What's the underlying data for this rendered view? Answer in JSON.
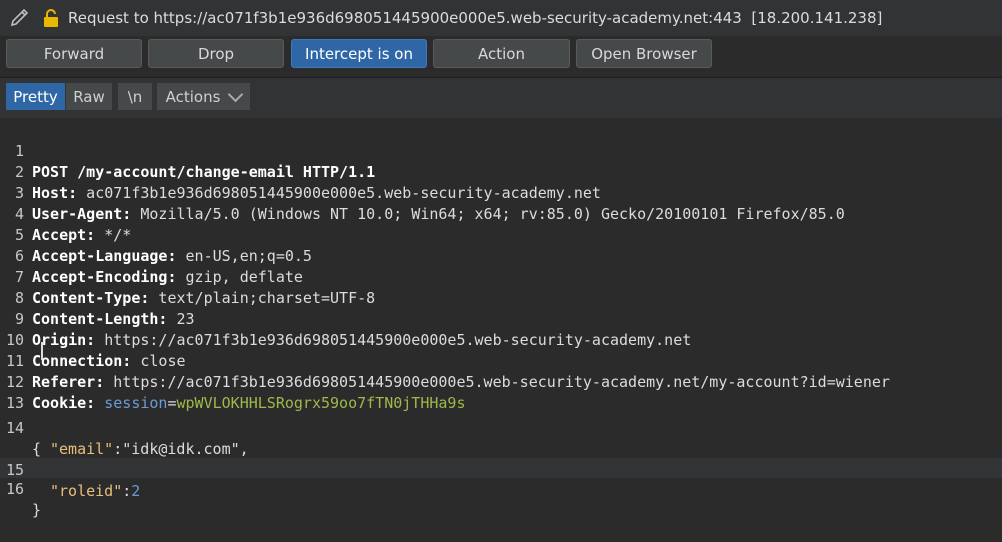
{
  "request_title": "Request to https://ac071f3b1e936d698051445900e000e5.web-security-academy.net:443",
  "request_ip": "[18.200.141.238]",
  "toolbar": {
    "forward": "Forward",
    "drop": "Drop",
    "intercept": "Intercept is on",
    "action": "Action",
    "open_browser": "Open Browser"
  },
  "view_tabs": {
    "pretty": "Pretty",
    "raw": "Raw",
    "newline": "\\n",
    "actions": "Actions"
  },
  "lines": {
    "l1": {
      "n": "1",
      "text": "POST /my-account/change-email HTTP/1.1"
    },
    "l2": {
      "n": "2",
      "key": "Host:",
      "val": " ac071f3b1e936d698051445900e000e5.web-security-academy.net"
    },
    "l3": {
      "n": "3",
      "key": "User-Agent:",
      "val": " Mozilla/5.0 (Windows NT 10.0; Win64; x64; rv:85.0) Gecko/20100101 Firefox/85.0"
    },
    "l4": {
      "n": "4",
      "key": "Accept:",
      "val": " */*"
    },
    "l5": {
      "n": "5",
      "key": "Accept-Language:",
      "val": " en-US,en;q=0.5"
    },
    "l6": {
      "n": "6",
      "key": "Accept-Encoding:",
      "val": " gzip, deflate"
    },
    "l7": {
      "n": "7",
      "key": "Content-Type:",
      "val": " text/plain;charset=UTF-8"
    },
    "l8": {
      "n": "8",
      "key": "Content-Length:",
      "val": " 23"
    },
    "l9": {
      "n": "9",
      "key": "Origin:",
      "val": " https://ac071f3b1e936d698051445900e000e5.web-security-academy.net"
    },
    "l10": {
      "n": "10",
      "key": "Connection:",
      "val": " close"
    },
    "l11": {
      "n": "11",
      "key": "Referer:",
      "val": " https://ac071f3b1e936d698051445900e000e5.web-security-academy.net/my-account?id=wiener"
    },
    "l12": {
      "n": "12",
      "key": "Cookie:",
      "ck": "session",
      "eq": "=",
      "cv": "wpWVLOKHHLSRogrx59oo7fTN0jTHHa9s"
    },
    "l13": {
      "n": "13"
    },
    "l14": {
      "n": "14",
      "brace": "{"
    },
    "l14b": {
      "jk": "\"email\"",
      "sep": ":",
      "jv": "\"idk@idk.com\","
    },
    "l15": {
      "n": "15",
      "jk": "\"roleid\"",
      "sep": ":",
      "num": "2"
    },
    "l16": {
      "n": "16",
      "brace": "}"
    }
  },
  "colors": {
    "accent": "#2f67a6",
    "json_key": "#e6c07b",
    "cookie_name": "#6a9bd8",
    "cookie_value": "#9fb84a"
  },
  "icons": [
    "pencil-icon",
    "lock-icon",
    "chevron-down-icon"
  ]
}
